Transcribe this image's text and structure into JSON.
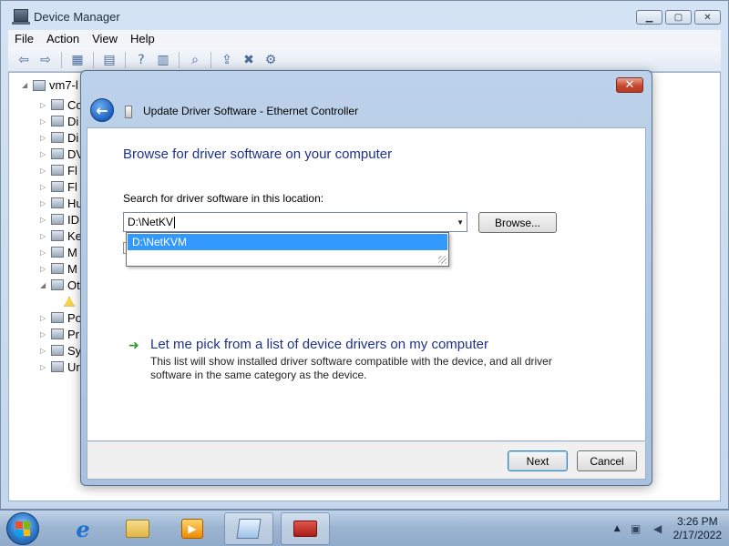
{
  "device_manager": {
    "title": "Device Manager",
    "menu": [
      "File",
      "Action",
      "View",
      "Help"
    ],
    "tree": {
      "root": "vm7-l",
      "items": [
        "Co",
        "Di",
        "Di",
        "DV",
        "Fl",
        "Fl",
        "Hu",
        "ID",
        "Ke",
        "M",
        "M",
        "Ot",
        "Po",
        "Pr",
        "Sy",
        "Ur"
      ]
    }
  },
  "dialog": {
    "title": "Update Driver Software - Ethernet Controller",
    "close_glyph": "✕",
    "heading": "Browse for driver software on your computer",
    "search_label": "Search for driver software in this location:",
    "path_value": "D:\\NetKV",
    "autocomplete_item": "D:\\NetKVM",
    "browse_label": "Browse...",
    "pick_title": "Let me pick from a list of device drivers on my computer",
    "pick_desc": "This list will show installed driver software compatible with the device, and all driver software in the same category as the device.",
    "next_label": "Next",
    "cancel_label": "Cancel"
  },
  "taskbar": {
    "time": "3:26 PM",
    "date": "2/17/2022",
    "apps": [
      "internet-explorer",
      "windows-explorer",
      "media-player",
      "notepad",
      "device-manager"
    ]
  },
  "colors": {
    "heading_blue": "#1e3287",
    "highlight": "#3399ff",
    "link_green": "#2e9c2e"
  }
}
